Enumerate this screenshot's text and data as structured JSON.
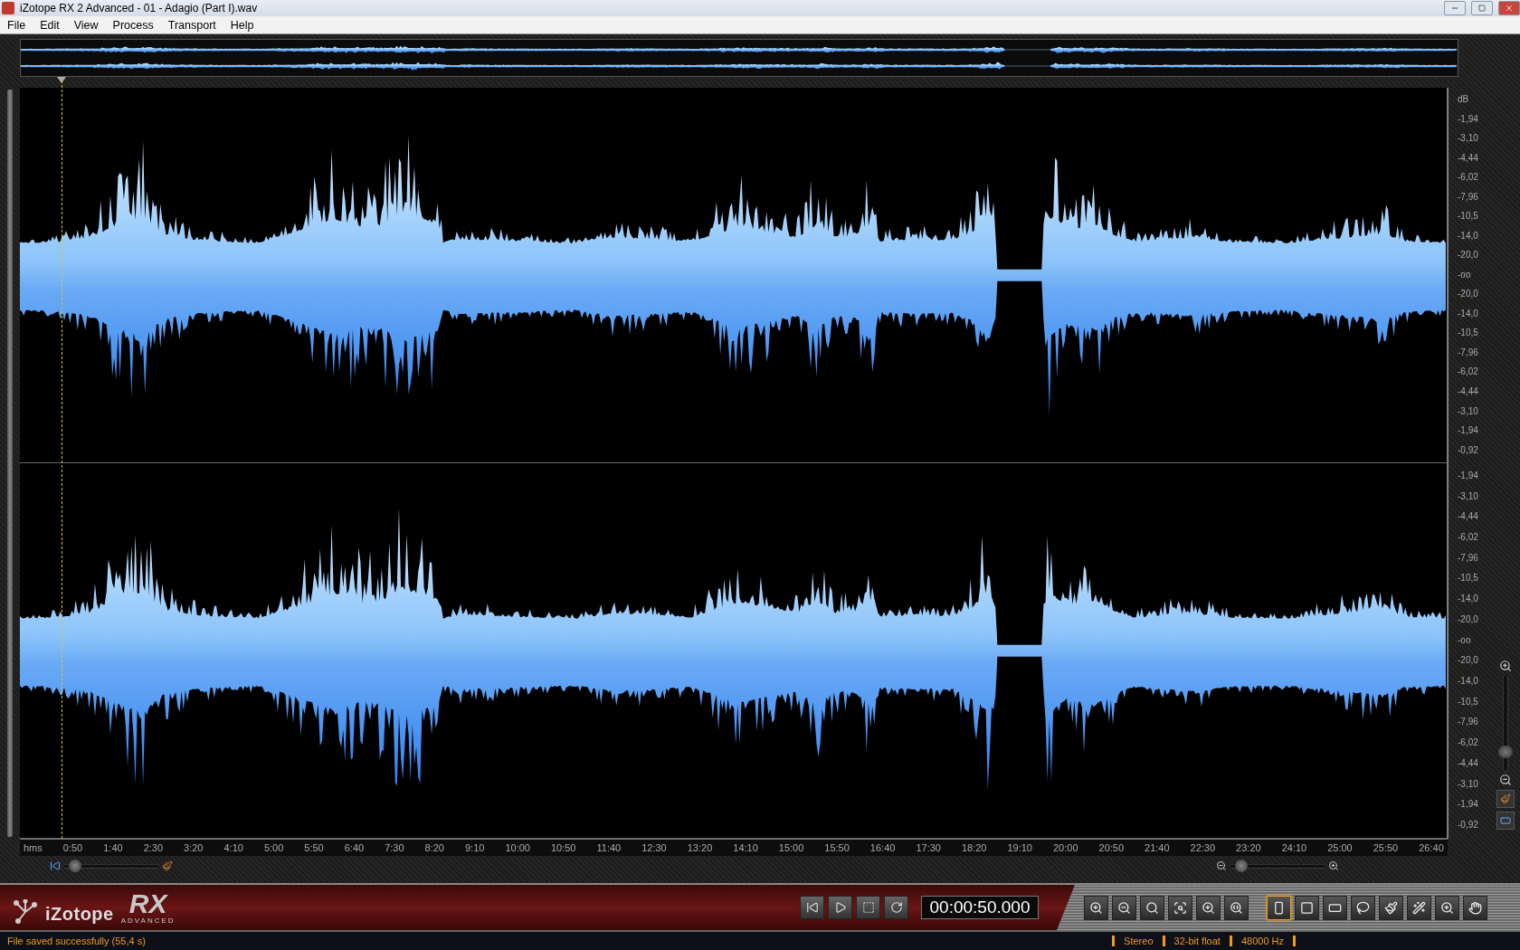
{
  "window": {
    "title": "iZotope RX 2 Advanced - 01 - Adagio (Part I).wav"
  },
  "menu": [
    "File",
    "Edit",
    "View",
    "Process",
    "Transport",
    "Help"
  ],
  "channels": [
    {
      "unit": "dB",
      "scale": [
        "-1,94",
        "-3,10",
        "-4,44",
        "-6,02",
        "-7,96",
        "-10,5",
        "-14,0",
        "-20,0",
        "-oo",
        "-20,0",
        "-14,0",
        "-10,5",
        "-7,96",
        "-6,02",
        "-4,44",
        "-3,10",
        "-1,94",
        "-0,92"
      ]
    },
    {
      "scale": [
        "-1,94",
        "-3,10",
        "-4,44",
        "-6,02",
        "-7,96",
        "-10,5",
        "-14,0",
        "-20,0",
        "-oo",
        "-20,0",
        "-14,0",
        "-10,5",
        "-7,96",
        "-6,02",
        "-4,44",
        "-3,10",
        "-1,94",
        "-0,92"
      ]
    }
  ],
  "ruler": {
    "unit": "hms",
    "ticks": [
      "0:50",
      "1:40",
      "2:30",
      "3:20",
      "4:10",
      "5:00",
      "5:50",
      "6:40",
      "7:30",
      "8:20",
      "9:10",
      "10:00",
      "10:50",
      "11:40",
      "12:30",
      "13:20",
      "14:10",
      "15:00",
      "15:50",
      "16:40",
      "17:30",
      "18:20",
      "19:10",
      "20:00",
      "20:50",
      "21:40",
      "22:30",
      "23:20",
      "24:10",
      "25:00",
      "25:50",
      "26:40"
    ]
  },
  "scroll": {
    "level": 0.05
  },
  "time_zoom": {
    "level": 0.05
  },
  "vertical_zoom": {
    "level": 0.15
  },
  "logo": {
    "brand": "iZotope",
    "product": "RX",
    "edition": "ADVANCED"
  },
  "transport": [
    {
      "kind": "to-start"
    },
    {
      "kind": "play"
    },
    {
      "kind": "play-selection"
    },
    {
      "kind": "loop"
    }
  ],
  "time_display": "00:00:50.000",
  "tools": [
    {
      "kind": "zoom-in",
      "selected": false
    },
    {
      "kind": "zoom-out",
      "selected": false
    },
    {
      "kind": "zoom-fit",
      "selected": false
    },
    {
      "kind": "zoom-selection",
      "selected": false
    },
    {
      "kind": "zoom-time",
      "selected": false
    },
    {
      "kind": "zoom-freq",
      "selected": false
    },
    {
      "kind": "time-select",
      "selected": true
    },
    {
      "kind": "rect-select",
      "selected": false
    },
    {
      "kind": "freq-select",
      "selected": false
    },
    {
      "kind": "lasso",
      "selected": false
    },
    {
      "kind": "brush",
      "selected": false
    },
    {
      "kind": "wand",
      "selected": false
    },
    {
      "kind": "magnifier",
      "selected": false
    },
    {
      "kind": "hand",
      "selected": false
    }
  ],
  "status": {
    "message": "File saved successfully (55,4 s)",
    "info": [
      "Stereo",
      "32-bit float",
      "48000 Hz"
    ]
  }
}
